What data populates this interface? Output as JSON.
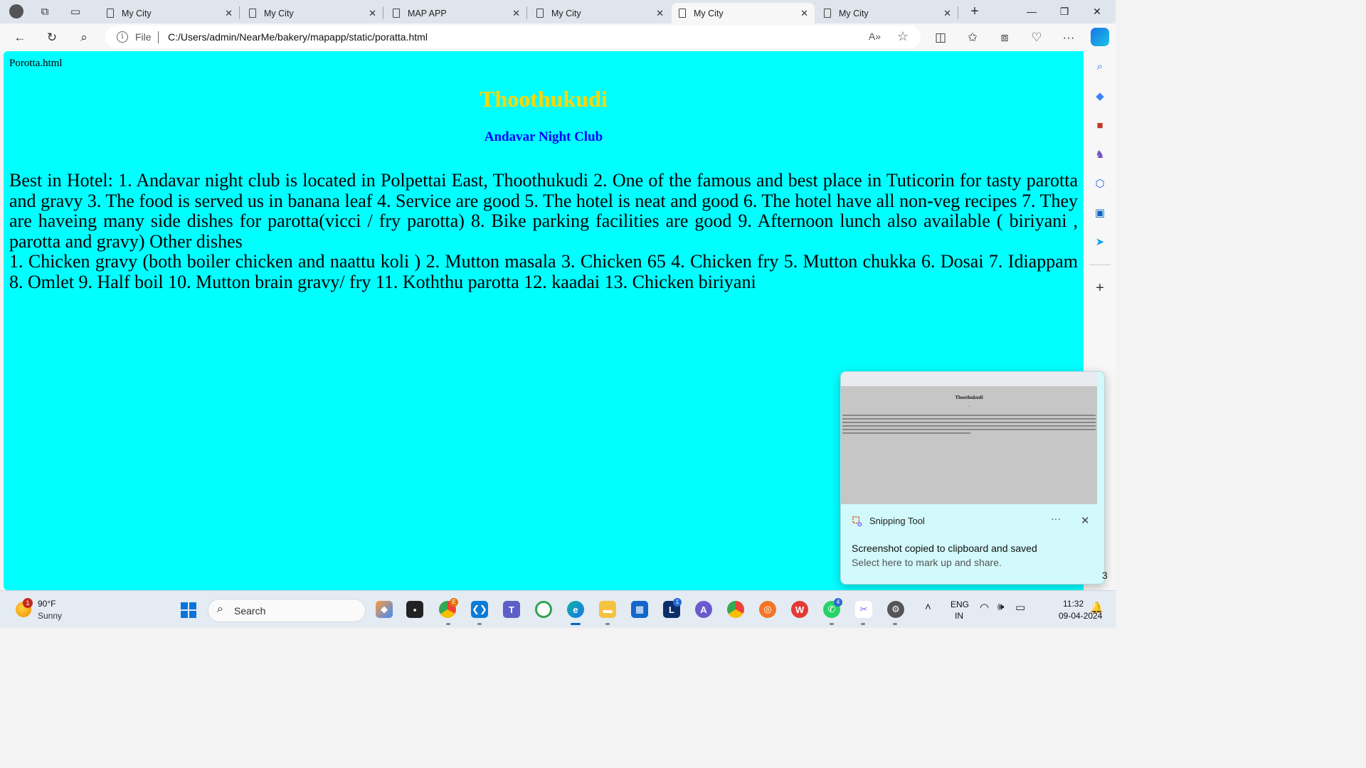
{
  "browser": {
    "tabs": [
      {
        "title": "My City",
        "active": false
      },
      {
        "title": "My City",
        "active": false
      },
      {
        "title": "MAP APP",
        "active": false
      },
      {
        "title": "My City",
        "active": false
      },
      {
        "title": "My City",
        "active": true
      },
      {
        "title": "My City",
        "active": false
      }
    ],
    "address": {
      "scheme_label": "File",
      "url": "C:/Users/admin/NearMe/bakery/mapapp/static/poratta.html"
    },
    "icons": {
      "profile": "profile-icon",
      "workspaces": "workspaces-icon",
      "tab_actions": "vertical-tabs-icon",
      "new_tab": "plus-icon",
      "read_aloud": "read-aloud-icon",
      "favorite": "star-icon",
      "split_screen": "split-screen-icon",
      "favorites": "favorites-icon",
      "collections": "collections-icon",
      "browser_essentials": "heart-icon",
      "more": "more-icon",
      "copilot": "copilot-icon"
    }
  },
  "page": {
    "file_label": "Porotta.html",
    "heading": "Thoothukudi",
    "subheading": "Andavar Night Club",
    "paragraph_1": "Best in Hotel: 1. Andavar night club is located in Polpettai East, Thoothukudi 2. One of the famous and best place in Tuticorin for tasty parotta and gravy 3. The food is served us in banana leaf 4. Service are good 5. The hotel is neat and good 6. The hotel have all non-veg recipes 7. They are haveing many side dishes for parotta(vicci / fry parotta) 8. Bike parking facilities are good 9. Afternoon lunch also available ( biriyani , parotta and gravy) Other dishes",
    "paragraph_2": "1. Chicken gravy (both boiler chicken and naattu koli ) 2. Mutton masala 3. Chicken 65 4. Chicken fry 5. Mutton chukka 6. Dosai 7. Idiappam 8. Omlet 9. Half boil 10. Mutton brain gravy/ fry 11. Koththu parotta 12. kaadai 13. Chicken biriyani",
    "colors": {
      "background": "#00ffff",
      "heading": "#ffd700",
      "subheading": "#0000ff"
    }
  },
  "notification": {
    "app_name": "Snipping Tool",
    "message": "Screenshot copied to clipboard and saved",
    "hint": "Select here to mark up and share.",
    "more_label": "···",
    "thumbnail": {
      "title": "Thoothukudi"
    }
  },
  "sidebar": {
    "icons": [
      "search-icon",
      "tag-icon",
      "toolbox-icon",
      "chess-icon",
      "copilot-hexagon-icon",
      "outlook-icon",
      "send-icon",
      "add-icon"
    ]
  },
  "taskbar": {
    "weather": {
      "temp": "90°F",
      "condition": "Sunny",
      "badge": "1"
    },
    "search_label": "Search",
    "badges": {
      "chrome": "E",
      "lens": "1",
      "whatsapp": "4"
    },
    "language": {
      "line1": "ENG",
      "line2": "IN"
    },
    "clock": {
      "time": "11:32",
      "date": "09-04-2024"
    },
    "partial_digit": "3"
  }
}
